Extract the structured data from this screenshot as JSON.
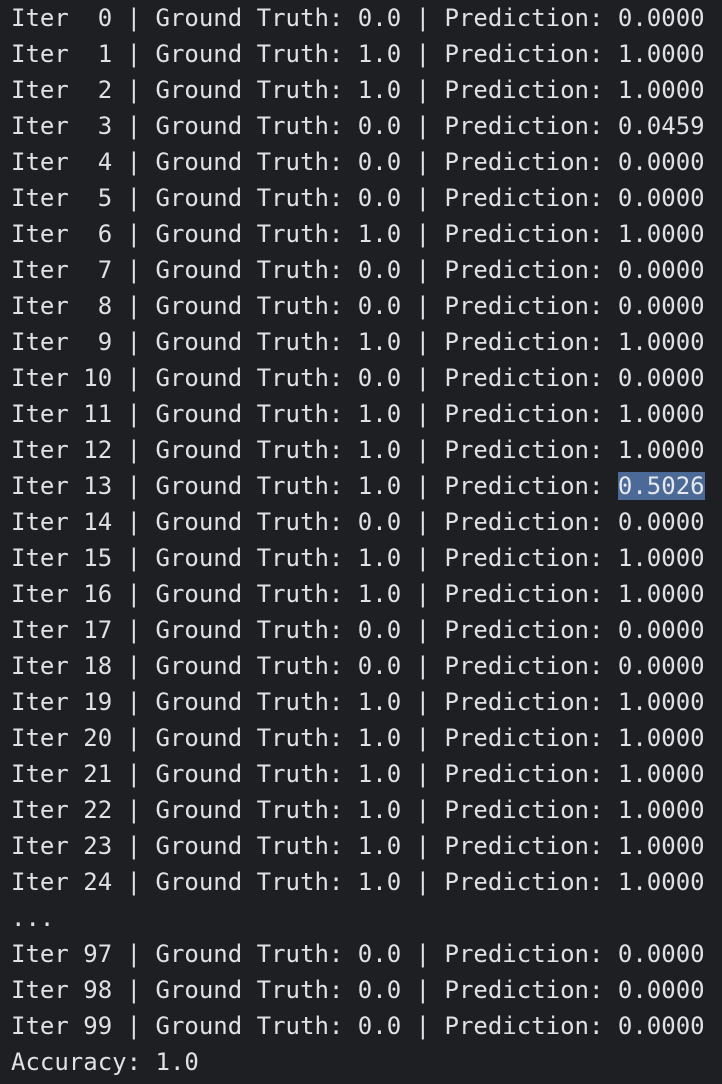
{
  "console": {
    "highlighted_row": "13",
    "rows_before": [
      {
        "iter": " 0",
        "gt": "0.0",
        "pred": "0.0000"
      },
      {
        "iter": " 1",
        "gt": "1.0",
        "pred": "1.0000"
      },
      {
        "iter": " 2",
        "gt": "1.0",
        "pred": "1.0000"
      },
      {
        "iter": " 3",
        "gt": "0.0",
        "pred": "0.0459"
      },
      {
        "iter": " 4",
        "gt": "0.0",
        "pred": "0.0000"
      },
      {
        "iter": " 5",
        "gt": "0.0",
        "pred": "0.0000"
      },
      {
        "iter": " 6",
        "gt": "1.0",
        "pred": "1.0000"
      },
      {
        "iter": " 7",
        "gt": "0.0",
        "pred": "0.0000"
      },
      {
        "iter": " 8",
        "gt": "0.0",
        "pred": "0.0000"
      },
      {
        "iter": " 9",
        "gt": "1.0",
        "pred": "1.0000"
      },
      {
        "iter": "10",
        "gt": "0.0",
        "pred": "0.0000"
      },
      {
        "iter": "11",
        "gt": "1.0",
        "pred": "1.0000"
      },
      {
        "iter": "12",
        "gt": "1.0",
        "pred": "1.0000"
      },
      {
        "iter": "13",
        "gt": "1.0",
        "pred": "0.5026"
      },
      {
        "iter": "14",
        "gt": "0.0",
        "pred": "0.0000"
      },
      {
        "iter": "15",
        "gt": "1.0",
        "pred": "1.0000"
      },
      {
        "iter": "16",
        "gt": "1.0",
        "pred": "1.0000"
      },
      {
        "iter": "17",
        "gt": "0.0",
        "pred": "0.0000"
      },
      {
        "iter": "18",
        "gt": "0.0",
        "pred": "0.0000"
      },
      {
        "iter": "19",
        "gt": "1.0",
        "pred": "1.0000"
      },
      {
        "iter": "20",
        "gt": "1.0",
        "pred": "1.0000"
      },
      {
        "iter": "21",
        "gt": "1.0",
        "pred": "1.0000"
      },
      {
        "iter": "22",
        "gt": "1.0",
        "pred": "1.0000"
      },
      {
        "iter": "23",
        "gt": "1.0",
        "pred": "1.0000"
      },
      {
        "iter": "24",
        "gt": "1.0",
        "pred": "1.0000"
      }
    ],
    "ellipsis": "...",
    "rows_after": [
      {
        "iter": "97",
        "gt": "0.0",
        "pred": "0.0000"
      },
      {
        "iter": "98",
        "gt": "0.0",
        "pred": "0.0000"
      },
      {
        "iter": "99",
        "gt": "0.0",
        "pred": "0.0000"
      }
    ],
    "accuracy_line": "Accuracy: 1.0",
    "labels": {
      "iter": "Iter ",
      "ground_truth": " | Ground Truth: ",
      "prediction": " | Prediction: "
    },
    "colors": {
      "background": "#1e1f22",
      "text": "#dfe1e5",
      "selection": "#4b6a97"
    }
  }
}
